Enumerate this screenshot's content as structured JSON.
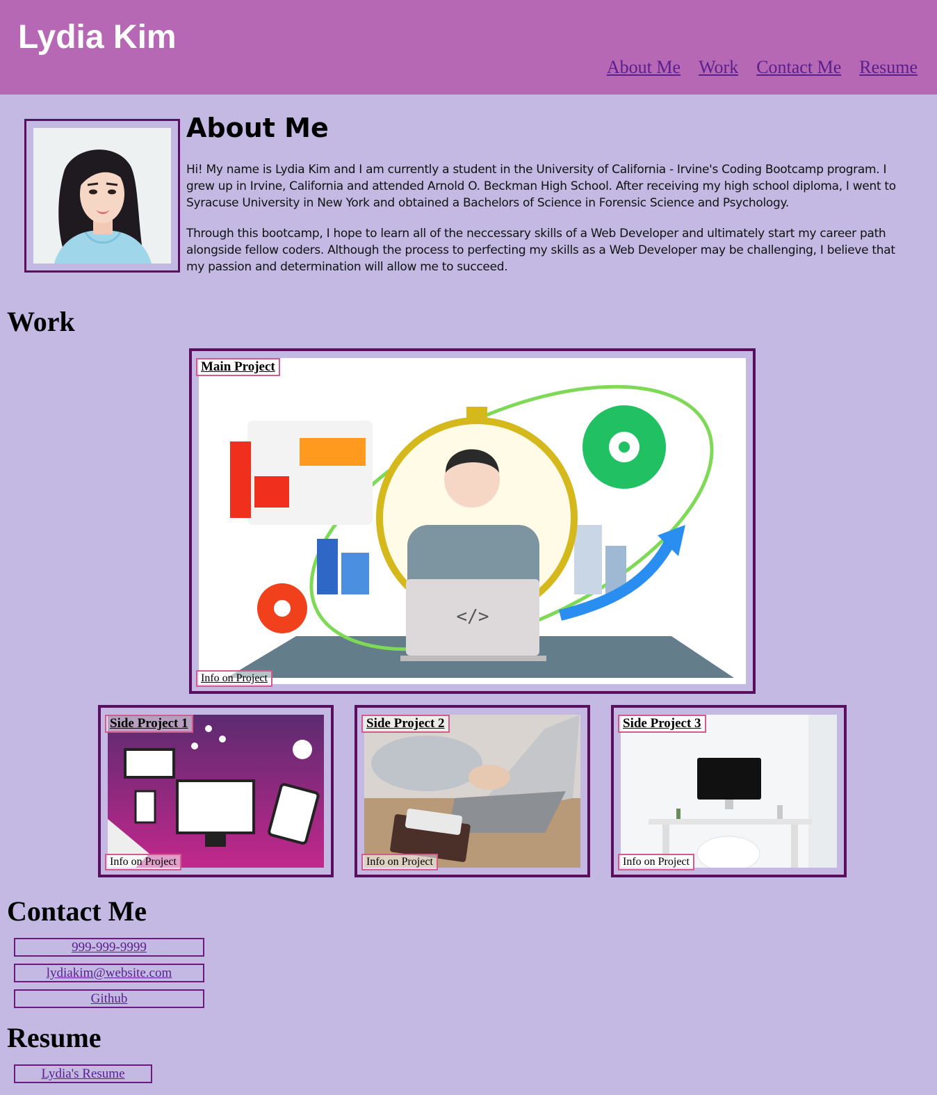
{
  "header": {
    "title": "Lydia Kim",
    "nav": [
      "About Me",
      "Work",
      "Contact Me",
      "Resume"
    ]
  },
  "about": {
    "title": "About Me",
    "paragraphs": [
      "Hi! My name is Lydia Kim and I am currently a student in the University of California - Irvine's Coding Bootcamp program. I grew up in Irvine, California and attended Arnold O. Beckman High School. After receiving my high school diploma, I went to Syracuse University in New York and obtained a Bachelors of Science in Forensic Science and Psychology.",
      "Through this bootcamp, I hope to learn all of the neccessary skills of a Web Developer and ultimately start my career path alongside fellow coders. Although the process to perfecting my skills as a Web Developer may be challenging, I believe that my passion and determination will allow me to succeed."
    ]
  },
  "work": {
    "title": "Work",
    "main": {
      "label": "Main Project",
      "info": "Info on Project"
    },
    "side": [
      {
        "label": "Side Project 1",
        "info": "Info on Project"
      },
      {
        "label": "Side Project 2",
        "info": "Info on Project"
      },
      {
        "label": "Side Project 3",
        "info": "Info on Project"
      }
    ]
  },
  "contact": {
    "title": "Contact Me",
    "phone": "999-999-9999",
    "email": "lydiakim@website.com",
    "github": "Github"
  },
  "resume": {
    "title": "Resume",
    "link": "Lydia's Resume"
  },
  "colors": {
    "header_bg": "#b668b5",
    "page_bg": "#c3b9e3",
    "border": "#5a0f5e",
    "label_border": "#d45a8c",
    "link": "#5a1f8c"
  }
}
